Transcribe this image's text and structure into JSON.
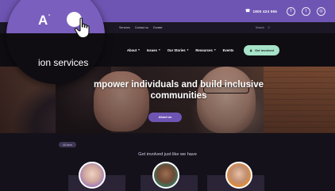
{
  "top_bar": {
    "phone": "1800 424 065",
    "social": [
      {
        "icon": "facebook-icon",
        "glyph": "f"
      },
      {
        "icon": "twitter-icon",
        "glyph": "t"
      },
      {
        "icon": "instagram-icon",
        "glyph": "◎"
      }
    ]
  },
  "sub_bar": {
    "links": [
      "Services",
      "Contact us",
      "Donate"
    ],
    "search_label": "Search"
  },
  "nav": {
    "items": [
      {
        "label": "About",
        "has_dropdown": true
      },
      {
        "label": "Issues",
        "has_dropdown": true
      },
      {
        "label": "Our Stories",
        "has_dropdown": true
      },
      {
        "label": "Resources",
        "has_dropdown": true
      },
      {
        "label": "Events",
        "has_dropdown": false
      }
    ],
    "cta_label": "Get involved"
  },
  "hero": {
    "headline": "mpower individuals and build inclusive communities",
    "button_label": "About us"
  },
  "lower": {
    "chip_label": "All done",
    "section_title": "Get involved just like we have"
  },
  "magnifier": {
    "font_size_label": "A",
    "font_size_sup": "-",
    "visible_text": "ion services"
  },
  "colors": {
    "brand_purple": "#6f55b3",
    "accent_mint": "#a6e3c8",
    "dark_bg": "#14111a"
  }
}
